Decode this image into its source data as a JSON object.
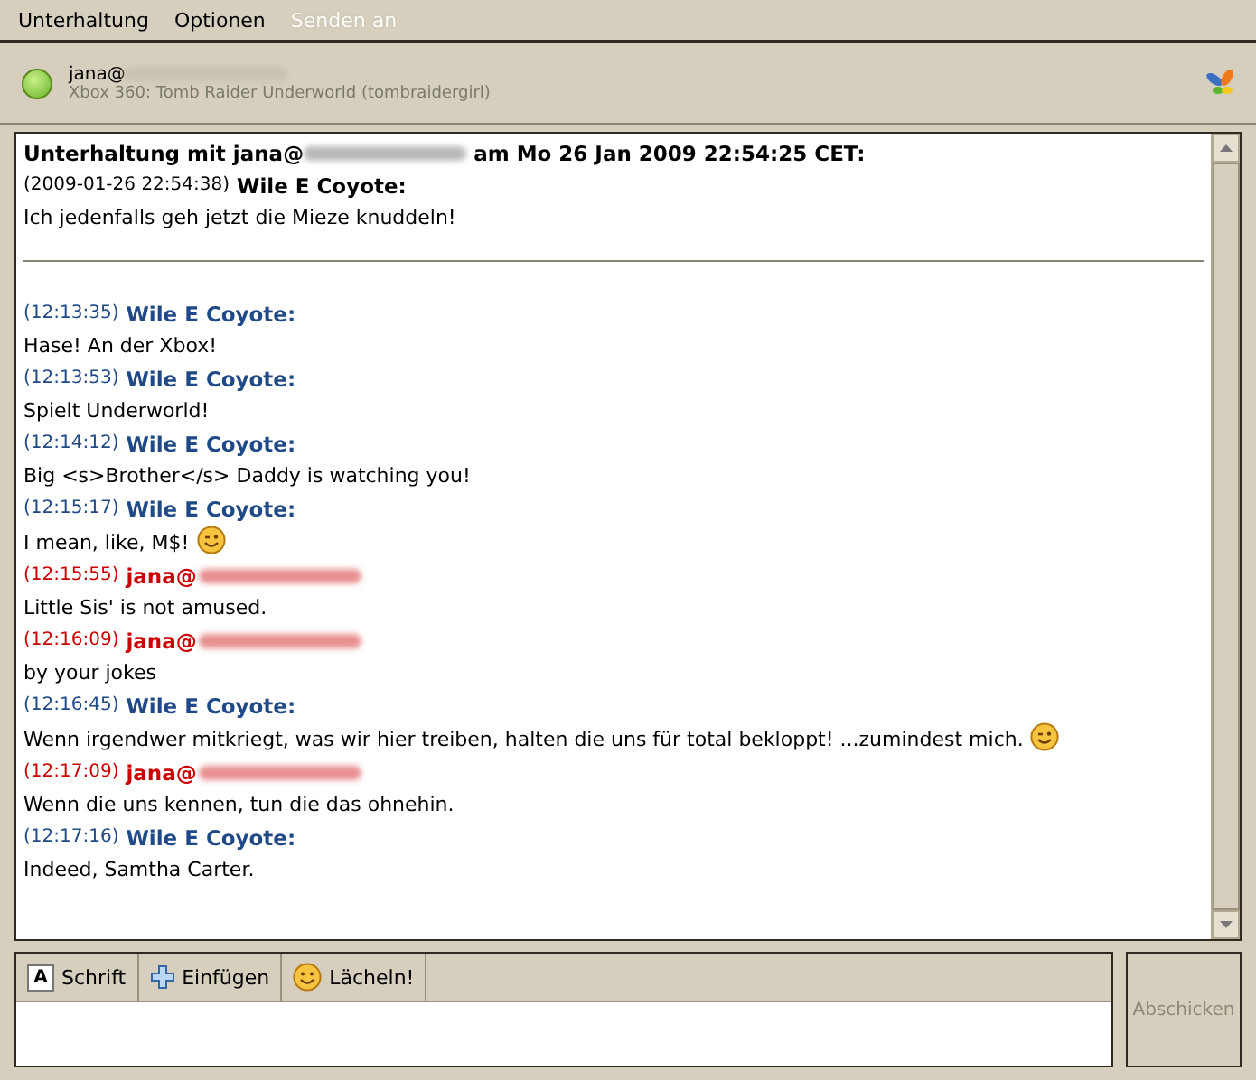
{
  "menu": [
    {
      "label": "Unterhaltung",
      "disabled": false
    },
    {
      "label": "Optionen",
      "disabled": false
    },
    {
      "label": "Senden an",
      "disabled": true
    }
  ],
  "contact": {
    "name": "jana@",
    "status_text": "Xbox 360: Tomb Raider Underworld (tombraidergirl)",
    "online": true
  },
  "conversation": {
    "header": {
      "prefix": "Unterhaltung mit jana@",
      "suffix": "am Mo 26 Jan 2009 22:54:25 CET:"
    },
    "messages": [
      {
        "kind": "history",
        "time": "(2009-01-26 22:54:38)",
        "sender": "Wile E Coyote:",
        "text": "Ich jedenfalls geh jetzt die Mieze knuddeln!",
        "redacted": false,
        "emoji": false
      },
      {
        "kind": "divider"
      },
      {
        "kind": "self",
        "time": "(12:13:35)",
        "sender": "Wile E Coyote:",
        "text": "Hase! An der Xbox!",
        "redacted": false,
        "emoji": false
      },
      {
        "kind": "self",
        "time": "(12:13:53)",
        "sender": "Wile E Coyote:",
        "text": "Spielt Underworld!",
        "redacted": false,
        "emoji": false
      },
      {
        "kind": "self",
        "time": "(12:14:12)",
        "sender": "Wile E Coyote:",
        "text": "Big <s>Brother</s> Daddy is watching you!",
        "redacted": false,
        "emoji": false
      },
      {
        "kind": "self",
        "time": "(12:15:17)",
        "sender": "Wile E Coyote:",
        "text": "I mean, like, M$!",
        "redacted": false,
        "emoji": true
      },
      {
        "kind": "other",
        "time": "(12:15:55)",
        "sender": "jana@",
        "text": "Little Sis' is not amused.",
        "redacted": true,
        "emoji": false
      },
      {
        "kind": "other",
        "time": "(12:16:09)",
        "sender": "jana@",
        "text": "by your jokes",
        "redacted": true,
        "emoji": false
      },
      {
        "kind": "self",
        "time": "(12:16:45)",
        "sender": "Wile E Coyote:",
        "text": "Wenn irgendwer mitkriegt, was wir hier treiben, halten die uns für total bekloppt! ...zumindest mich.",
        "redacted": false,
        "emoji": true
      },
      {
        "kind": "other",
        "time": "(12:17:09)",
        "sender": "jana@",
        "text": "Wenn die uns kennen, tun die das ohnehin.",
        "redacted": true,
        "emoji": false
      },
      {
        "kind": "self",
        "time": "(12:17:16)",
        "sender": "Wile E Coyote:",
        "text": "Indeed, Samtha Carter.",
        "redacted": false,
        "emoji": false
      }
    ]
  },
  "toolbar": [
    {
      "kind": "font",
      "label": "Schrift",
      "icon_letter": "A"
    },
    {
      "kind": "insert",
      "label": "Einfügen"
    },
    {
      "kind": "smile",
      "label": "Lächeln!"
    }
  ],
  "send_button": {
    "label": "Abschicken",
    "disabled": true
  }
}
